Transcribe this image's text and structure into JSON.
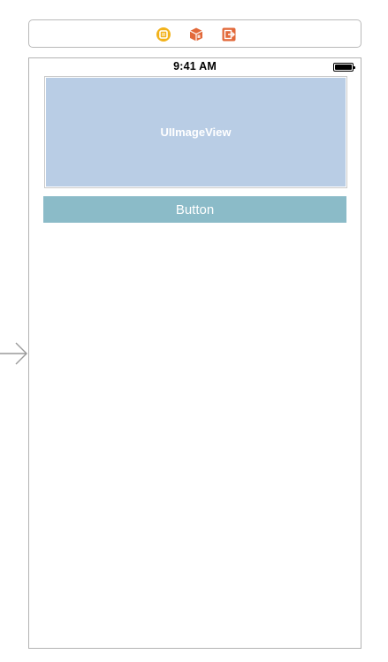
{
  "scene_dock": {
    "icons": [
      {
        "name": "view-controller-icon",
        "color": "#f2b21b"
      },
      {
        "name": "first-responder-icon",
        "color": "#e2693a"
      },
      {
        "name": "exit-icon",
        "color": "#e2693a"
      }
    ]
  },
  "device": {
    "status_bar": {
      "time": "9:41 AM"
    },
    "image_view": {
      "label": "UIImageView",
      "background": "#b9cde5"
    },
    "button": {
      "label": "Button",
      "background": "#8bbbc8"
    }
  },
  "entry_point": {
    "icon": "arrow-right-icon"
  }
}
